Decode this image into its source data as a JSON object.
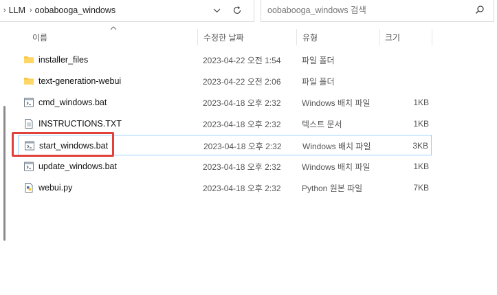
{
  "address_bar": {
    "crumbs": [
      "LLM",
      "oobabooga_windows"
    ]
  },
  "search": {
    "placeholder": "oobabooga_windows 검색"
  },
  "columns": {
    "name": "이름",
    "date": "수정한 날짜",
    "type": "유형",
    "size": "크기"
  },
  "files": [
    {
      "name": "installer_files",
      "date": "2023-04-22 오전 1:54",
      "type": "파일 폴더",
      "size": "",
      "icon": "folder-icon"
    },
    {
      "name": "text-generation-webui",
      "date": "2023-04-22 오전 2:06",
      "type": "파일 폴더",
      "size": "",
      "icon": "folder-icon"
    },
    {
      "name": "cmd_windows.bat",
      "date": "2023-04-18 오후 2:32",
      "type": "Windows 배치 파일",
      "size": "1KB",
      "icon": "batch-file-icon"
    },
    {
      "name": "INSTRUCTIONS.TXT",
      "date": "2023-04-18 오후 2:32",
      "type": "텍스트 문서",
      "size": "1KB",
      "icon": "text-file-icon"
    },
    {
      "name": "start_windows.bat",
      "date": "2023-04-18 오후 2:32",
      "type": "Windows 배치 파일",
      "size": "3KB",
      "icon": "batch-file-icon"
    },
    {
      "name": "update_windows.bat",
      "date": "2023-04-18 오후 2:32",
      "type": "Windows 배치 파일",
      "size": "1KB",
      "icon": "batch-file-icon"
    },
    {
      "name": "webui.py",
      "date": "2023-04-18 오후 2:32",
      "type": "Python 원본 파일",
      "size": "7KB",
      "icon": "python-file-icon"
    }
  ],
  "colors": {
    "folder": "#f5c542",
    "selection_border": "#99d1ff",
    "highlight": "#e0413a"
  }
}
